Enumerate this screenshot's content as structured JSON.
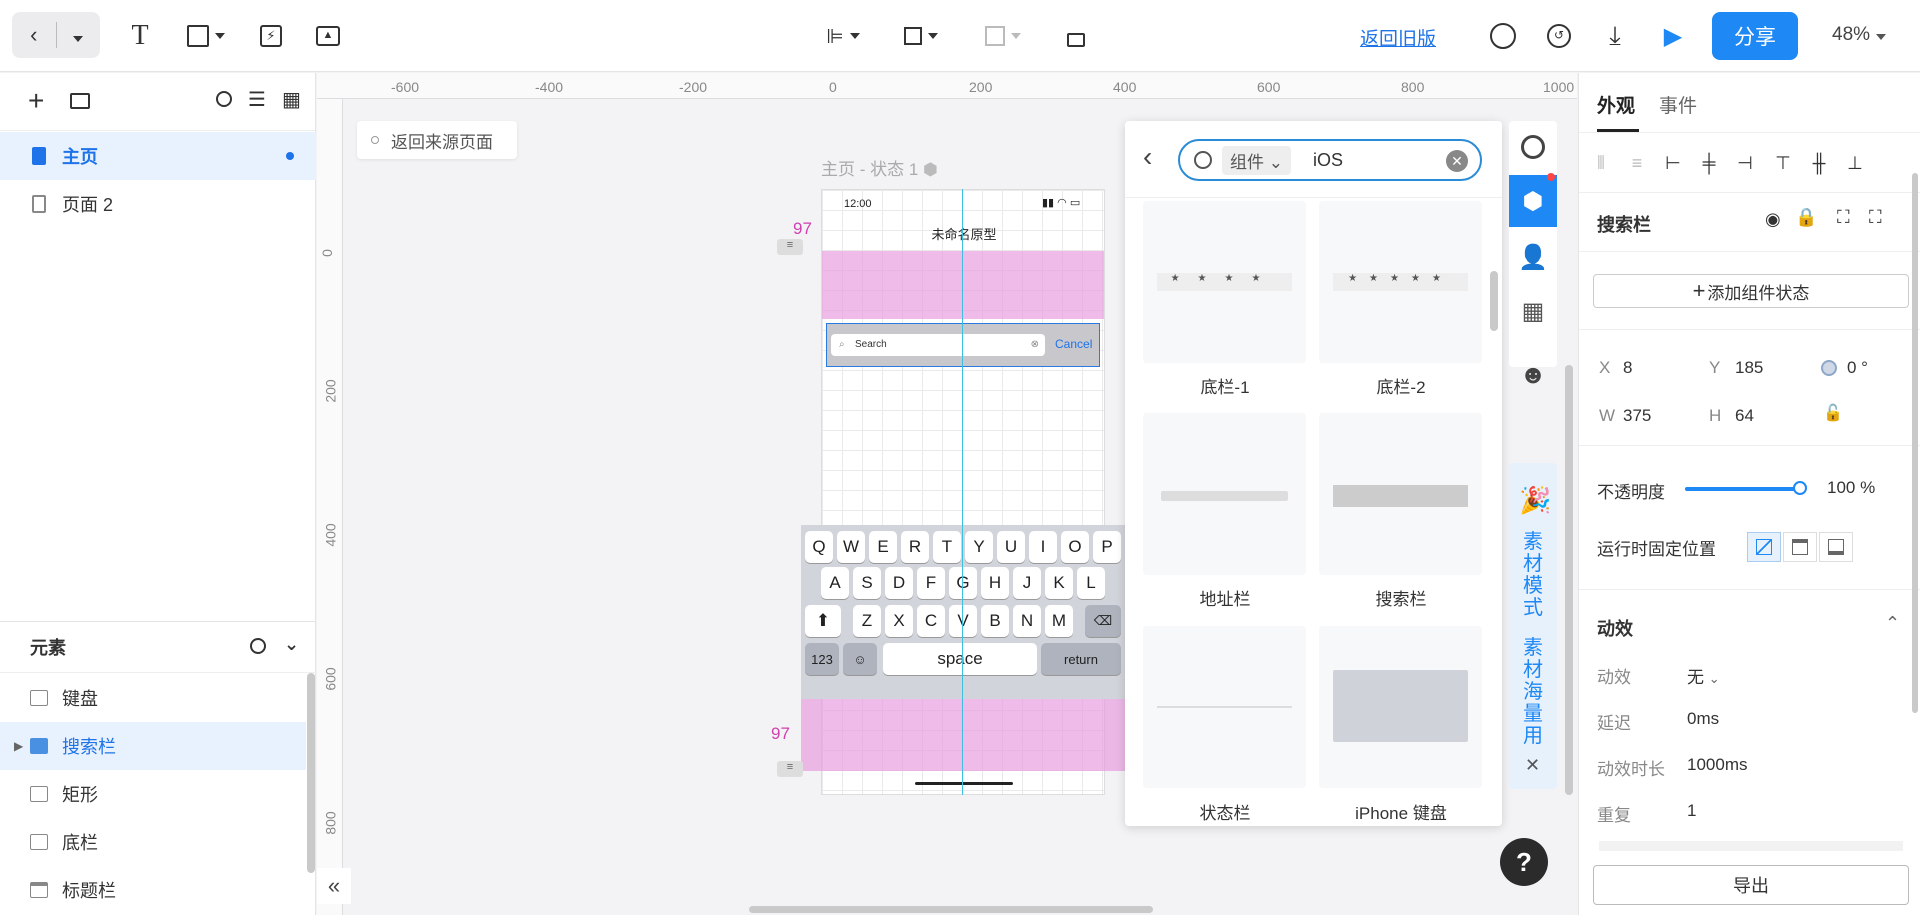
{
  "toolbar": {
    "return_old_version": "返回旧版",
    "share": "分享",
    "zoom": "48%"
  },
  "pages_panel": {
    "items": [
      {
        "label": "主页",
        "active": true
      },
      {
        "label": "页面 2",
        "active": false
      }
    ]
  },
  "elements_panel": {
    "title": "元素",
    "items": [
      {
        "label": "键盘",
        "icon": "keyboard-icon"
      },
      {
        "label": "搜索栏",
        "icon": "folder-icon",
        "active": true
      },
      {
        "label": "矩形",
        "icon": "rectangle-icon"
      },
      {
        "label": "底栏",
        "icon": "rectangle-icon"
      },
      {
        "label": "标题栏",
        "icon": "titlebar-icon"
      }
    ]
  },
  "canvas": {
    "back_to_source": "返回来源页面",
    "state_label": "主页 - 状态 1",
    "ruler_h": [
      "-600",
      "-400",
      "-200",
      "0",
      "200",
      "400",
      "600",
      "800",
      "1000"
    ],
    "ruler_v": [
      "0",
      "200",
      "400",
      "600",
      "800"
    ],
    "spacing_top": "97",
    "spacing_bottom": "97",
    "phone": {
      "time": "12:00",
      "title": "未命名原型",
      "search_placeholder": "Search",
      "cancel": "Cancel"
    },
    "keyboard": {
      "row1": [
        "Q",
        "W",
        "E",
        "R",
        "T",
        "Y",
        "U",
        "I",
        "O",
        "P"
      ],
      "row2": [
        "A",
        "S",
        "D",
        "F",
        "G",
        "H",
        "J",
        "K",
        "L"
      ],
      "row3": [
        "Z",
        "X",
        "C",
        "V",
        "B",
        "N",
        "M"
      ],
      "num_key": "123",
      "space": "space",
      "return": "return"
    }
  },
  "component_popup": {
    "filter_chip": "组件",
    "search_value": "iOS",
    "components": [
      {
        "label": "底栏-1"
      },
      {
        "label": "底栏-2"
      },
      {
        "label": "地址栏"
      },
      {
        "label": "搜索栏"
      },
      {
        "label": "状态栏"
      },
      {
        "label": "iPhone 键盘"
      }
    ],
    "material_text_1": "素材模式",
    "material_text_2": "素材海量用"
  },
  "right_panel": {
    "tabs": [
      "外观",
      "事件"
    ],
    "component_name": "搜索栏",
    "add_state": "添加组件状态",
    "x_label": "X",
    "x": "8",
    "y_label": "Y",
    "y": "185",
    "rotation": "0 °",
    "w_label": "W",
    "w": "375",
    "h_label": "H",
    "h": "64",
    "opacity_label": "不透明度",
    "opacity": "100 %",
    "opacity_value": 1.0,
    "fixed_position_label": "运行时固定位置",
    "animation_title": "动效",
    "anim_label": "动效",
    "anim_value": "无",
    "delay_label": "延迟",
    "delay_value": "0ms",
    "duration_label": "动效时长",
    "duration_value": "1000ms",
    "repeat_label": "重复",
    "repeat_value": "1",
    "export": "导出"
  },
  "colors": {
    "accent": "#1e88f5",
    "spacing_highlight": "#e696dc",
    "spacing_number": "#d23fb0"
  }
}
